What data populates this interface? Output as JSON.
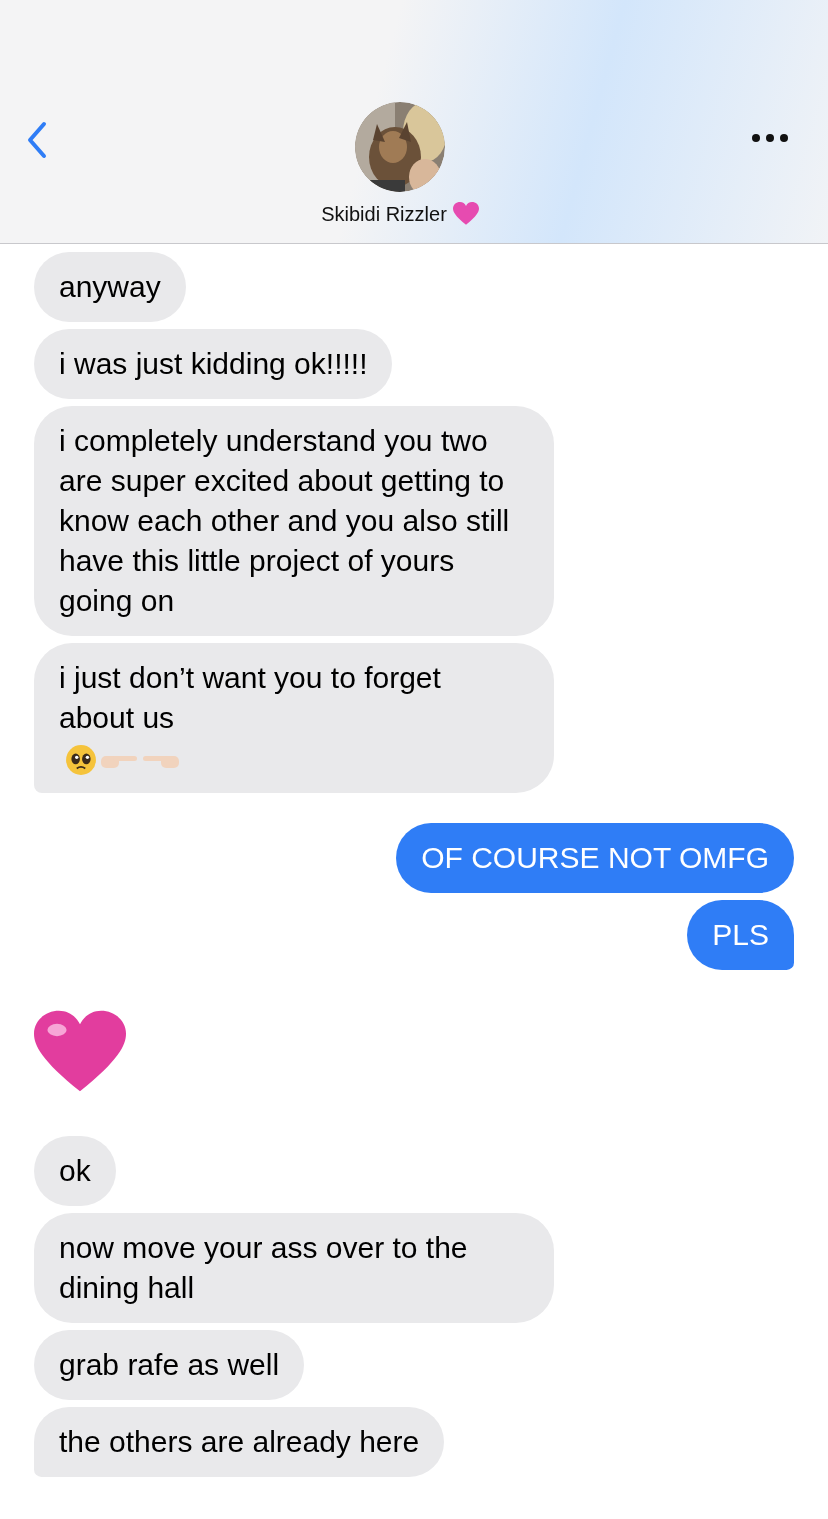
{
  "contact": {
    "name": "Skibidi Rizzler"
  },
  "messages": [
    {
      "outgoing": false,
      "kind": "text",
      "text": "anyway",
      "tail": false
    },
    {
      "outgoing": false,
      "kind": "text",
      "text": "i was just kidding ok!!!!!",
      "tail": false
    },
    {
      "outgoing": false,
      "kind": "text",
      "text": "i completely understand you two are super excited about getting to know each other and you also still have this little project of yours going on",
      "tail": false
    },
    {
      "outgoing": false,
      "kind": "text",
      "text": "i just don’t want you to forget about us",
      "trailing_emoji": true,
      "tail": true
    },
    {
      "outgoing": true,
      "kind": "text",
      "text": "OF COURSE NOT OMFG",
      "tail": false
    },
    {
      "outgoing": true,
      "kind": "text",
      "text": "PLS",
      "tail": true
    },
    {
      "outgoing": false,
      "kind": "heart"
    },
    {
      "outgoing": false,
      "kind": "text",
      "text": "ok",
      "tail": false
    },
    {
      "outgoing": false,
      "kind": "text",
      "text": "now move your ass over to the dining hall",
      "tail": false
    },
    {
      "outgoing": false,
      "kind": "text",
      "text": "grab rafe as well",
      "tail": false
    },
    {
      "outgoing": false,
      "kind": "text",
      "text": "the others are already here",
      "tail": true
    }
  ]
}
